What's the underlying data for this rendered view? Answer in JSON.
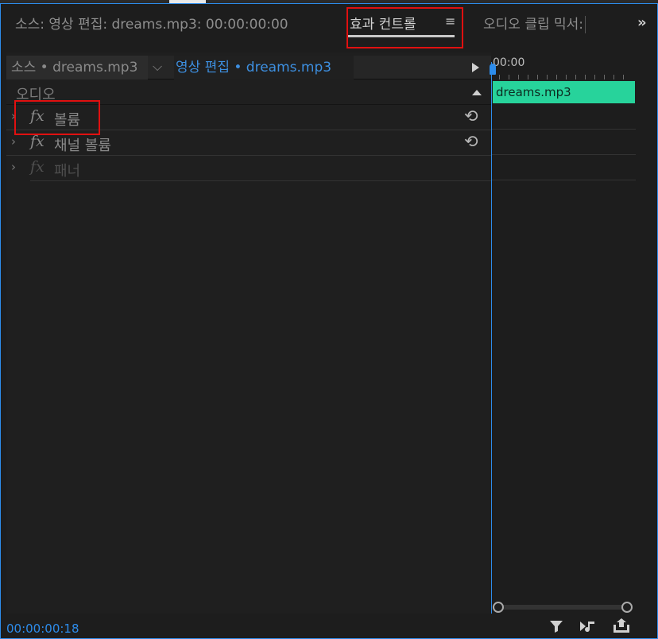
{
  "tabs": {
    "source": "소스: 영상 편집: dreams.mp3: 00:00:00:00",
    "effect_controls": "효과 컨트롤",
    "menu_glyph": "≡",
    "audio_mixer": "오디오 클립 믹서:",
    "more_glyph": "»"
  },
  "header": {
    "source_clip": "소스 • dreams.mp3",
    "chevron": "⌵",
    "sequence_clip": "영상 편집 • dreams.mp3"
  },
  "section": {
    "title": "오디오"
  },
  "effects": [
    {
      "label": "볼륨",
      "fx": "fx",
      "reset": "⟲"
    },
    {
      "label": "채널 볼륨",
      "fx": "fx",
      "reset": "⟲"
    },
    {
      "label": "패너",
      "fx": "fx"
    }
  ],
  "timeline": {
    "time": "00:00",
    "clip_name": "dreams.mp3"
  },
  "footer": {
    "timecode": "00:00:00:18",
    "icons": [
      "filter-icon",
      "play-audio-icon",
      "export-icon"
    ]
  },
  "colors": {
    "accent": "#2d8ceb",
    "clip": "#27d39b",
    "highlight": "#e01010"
  }
}
